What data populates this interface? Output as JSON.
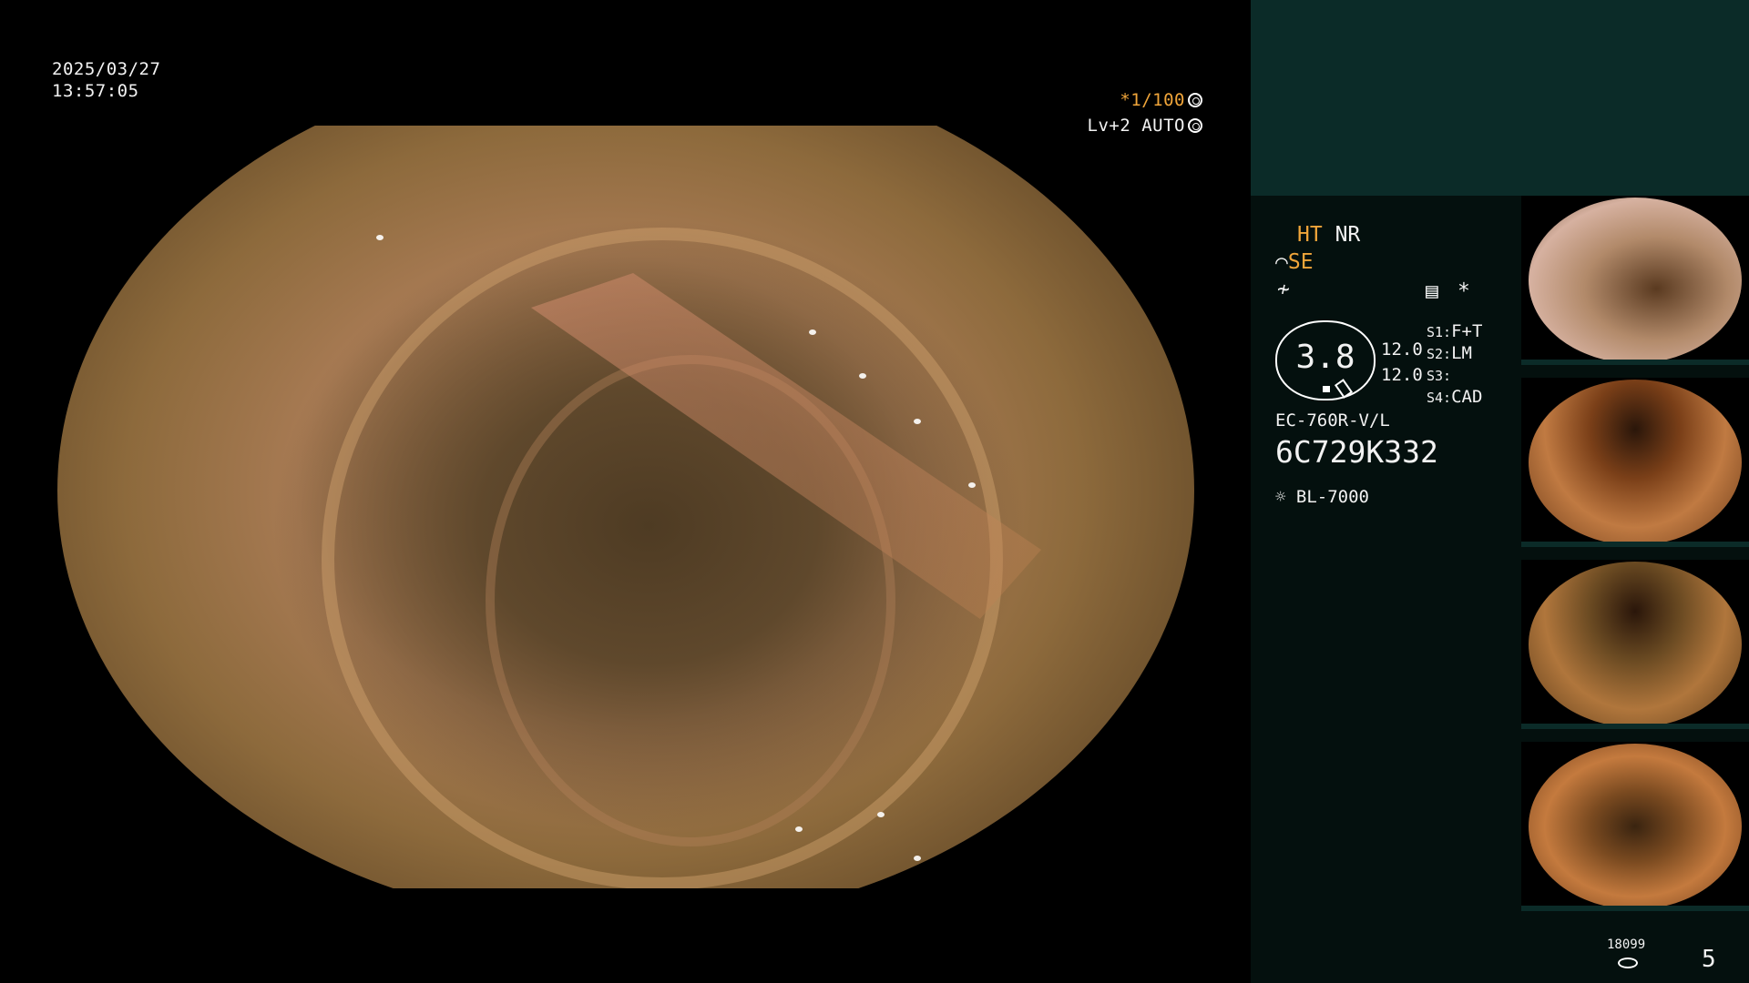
{
  "overlay": {
    "date": "2025/03/27",
    "time": "13:57:05",
    "shutter": "*1/100",
    "level": "Lv+2",
    "iris": "AUTO"
  },
  "panel": {
    "ht": "HT",
    "nr": "NR",
    "se": "SE",
    "se_prefix_icon": "settings-curve-icon",
    "freeze_icon": "freeze-icon",
    "gauge_value": "3.8",
    "gain_1": "12.0",
    "gain_2": "12.0",
    "s1": "S1:",
    "s1_val": "F+T",
    "s2": "S2:",
    "s2_val": "LM",
    "s3": "S3:",
    "s3_val": "",
    "s4": "S4:",
    "s4_val": "CAD",
    "asterisk": "*",
    "scope_model": "EC-760R-V/L",
    "scope_serial": "6C729K332",
    "light_source": "BL-7000",
    "storage_count": "18099",
    "image_count": "5"
  },
  "colors": {
    "panel_bg": "#04100e",
    "panel_top": "#0b2b28",
    "accent_orange": "#f0a53a",
    "text": "#f2f2f2"
  }
}
